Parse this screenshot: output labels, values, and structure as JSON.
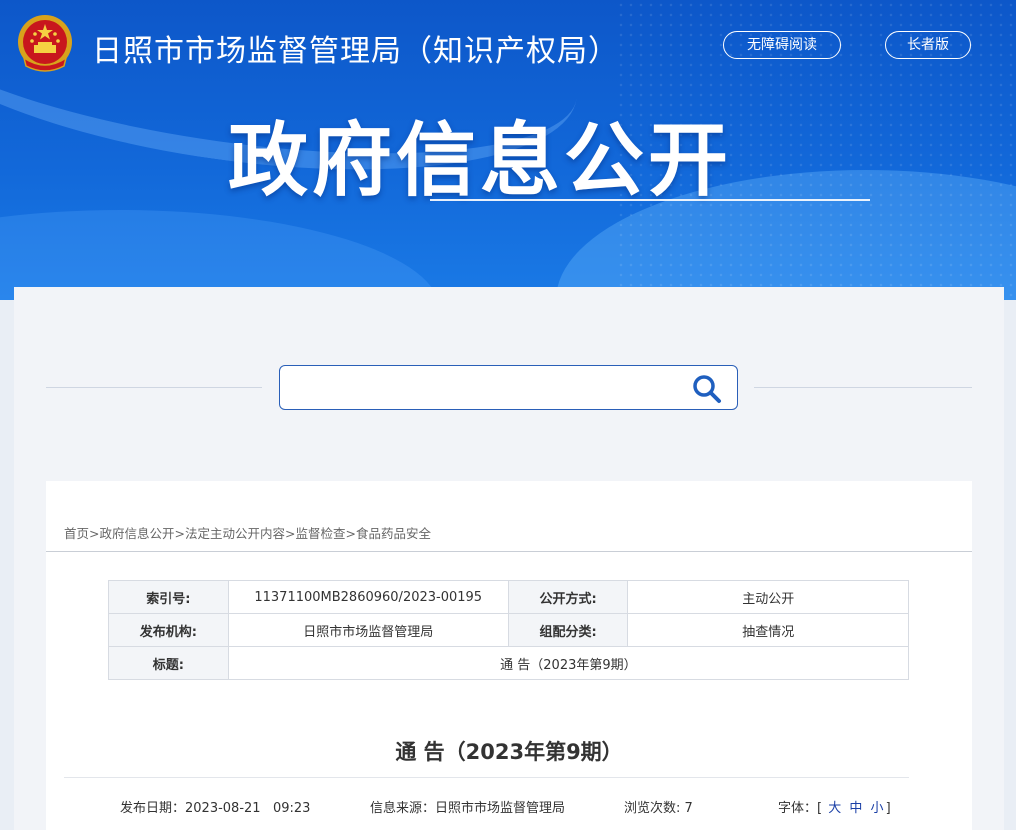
{
  "header": {
    "site_title": "日照市市场监督管理局（知识产权局）",
    "accessibility_button": "无障碍阅读",
    "elder_button": "长者版",
    "banner_title": "政府信息公开"
  },
  "search": {
    "placeholder": ""
  },
  "breadcrumb": {
    "items": [
      "首页",
      "政府信息公开",
      "法定主动公开内容",
      "监督检查",
      "食品药品安全"
    ],
    "separator": ">"
  },
  "meta_table": {
    "index_label": "索引号:",
    "index_value": "11371100MB2860960/2023-00195",
    "disclosure_label": "公开方式:",
    "disclosure_value": "主动公开",
    "publisher_label": "发布机构:",
    "publisher_value": "日照市市场监督管理局",
    "category_label": "组配分类:",
    "category_value": "抽查情况",
    "title_label": "标题:",
    "title_value": "通 告（2023年第9期）"
  },
  "document": {
    "title": "通 告（2023年第9期）",
    "date_label": "发布日期：",
    "date_value": "2023-08-21   09:23",
    "source_label": "信息来源：",
    "source_value": "日照市市场监督管理局",
    "views_label": "浏览次数:",
    "views_value": "7",
    "font_label": "字体：",
    "font_open": "[",
    "font_large": "大",
    "font_medium": "中",
    "font_small": "小",
    "font_close": "]"
  },
  "colors": {
    "banner_blue": "#1268d9",
    "search_border": "#2a5fb8",
    "font_link": "#1a3fa6"
  }
}
